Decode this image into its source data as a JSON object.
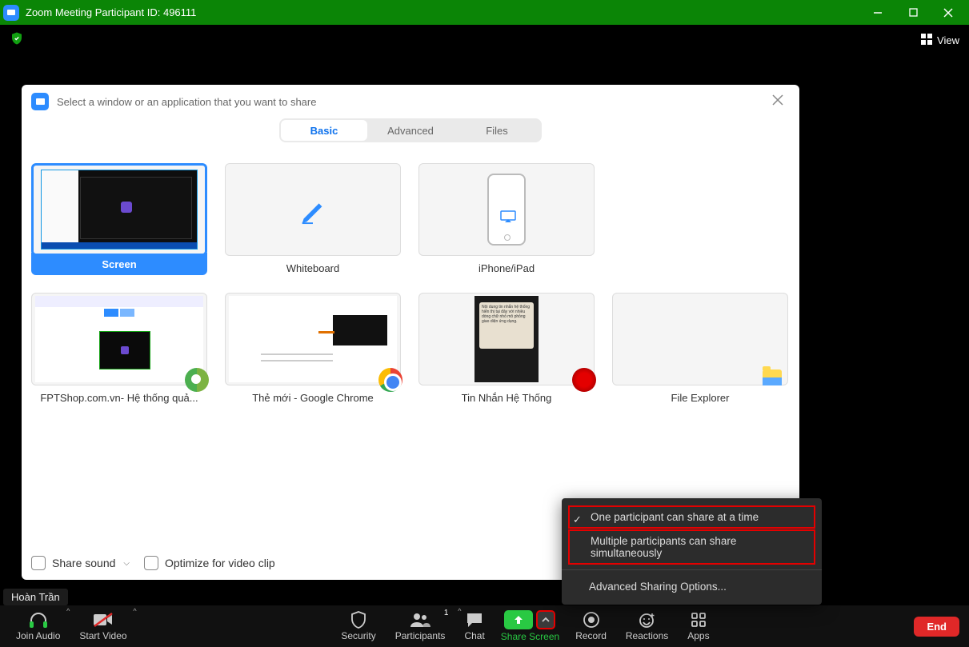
{
  "titlebar": {
    "text": "Zoom Meeting Participant ID: 496111"
  },
  "topbar": {
    "view_label": "View"
  },
  "share_dialog": {
    "title": "Select a window or an application that you want to share",
    "tabs": {
      "basic": "Basic",
      "advanced": "Advanced",
      "files": "Files"
    },
    "items": {
      "screen": "Screen",
      "whiteboard": "Whiteboard",
      "iphone": "iPhone/iPad",
      "app1": "FPTShop.com.vn- Hệ thống quả...",
      "app2": "Thẻ mới - Google Chrome",
      "app3": "Tin Nhắn Hệ Thống",
      "app4": "File Explorer"
    },
    "options": {
      "share_sound": "Share sound",
      "optimize_clip": "Optimize for video clip"
    }
  },
  "popup": {
    "one": "One participant can share at a time",
    "multi": "Multiple participants can share simultaneously",
    "advanced": "Advanced Sharing Options..."
  },
  "username": "Hoàn Trần",
  "toolbar": {
    "join_audio": "Join Audio",
    "start_video": "Start Video",
    "security": "Security",
    "participants": "Participants",
    "participants_count": "1",
    "chat": "Chat",
    "share_screen": "Share Screen",
    "record": "Record",
    "reactions": "Reactions",
    "apps": "Apps",
    "end": "End"
  }
}
